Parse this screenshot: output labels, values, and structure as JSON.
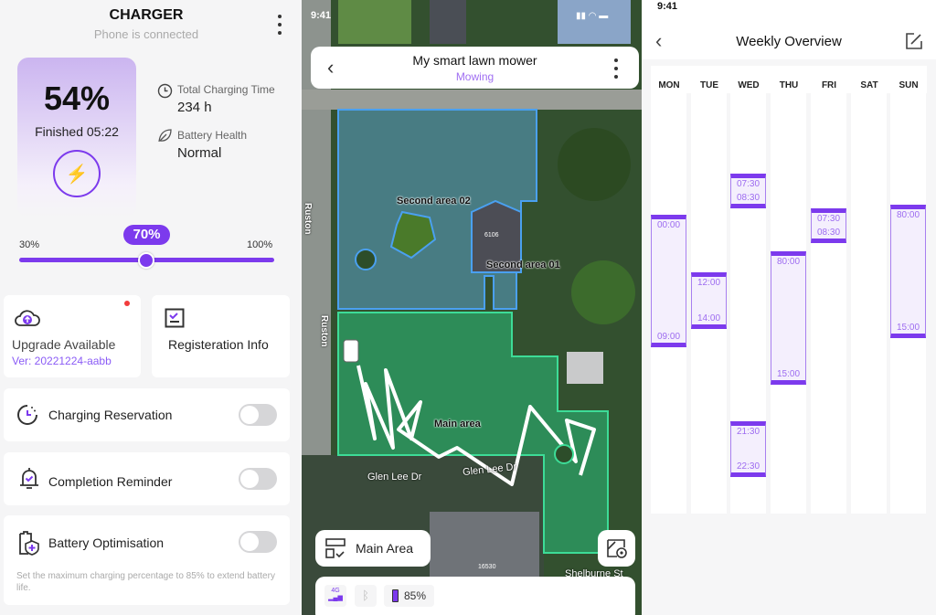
{
  "charger": {
    "title": "CHARGER",
    "subtitle": "Phone is connected",
    "battery_percent": "54%",
    "finished": "Finished 05:22",
    "total_time_label": "Total Charging Time",
    "total_time_value": "234 h",
    "health_label": "Battery Health",
    "health_value": "Normal",
    "slider": {
      "min_label": "30%",
      "max_label": "100%",
      "value_label": "70%",
      "value": 70,
      "min": 30,
      "max": 100
    },
    "upgrade": {
      "label": "Upgrade Available",
      "version": "Ver: 20221224-aabb"
    },
    "registration": {
      "label": "Registeration Info"
    },
    "toggles": [
      {
        "label": "Charging Reservation",
        "on": false
      },
      {
        "label": "Completion Reminder",
        "on": false
      },
      {
        "label": "Battery Optimisation",
        "on": false
      }
    ],
    "optimisation_note": "Set the maximum charging percentage to 85% to extend battery life.",
    "accent": "#7c3aed"
  },
  "mower": {
    "status_time": "9:41",
    "title": "My smart lawn mower",
    "status": "Mowing",
    "map_labels": {
      "area02": "Second area 02",
      "area01": "Second area 01",
      "main": "Main area",
      "street1": "Ruston",
      "street2": "Ruston",
      "street3": "Glen Lee Dr",
      "street4": "Glen Lee Dr",
      "street5": "Shelburne St",
      "house1": "6106",
      "house2": "16530"
    },
    "area_button": "Main Area",
    "battery": "85%",
    "network": "4G"
  },
  "weekly": {
    "status_time": "9:41",
    "title": "Weekly Overview",
    "days": [
      "MON",
      "TUE",
      "WED",
      "THU",
      "FRI",
      "SAT",
      "SUN"
    ],
    "blocks": [
      {
        "day": "MON",
        "start": "00:00",
        "end": "09:00"
      },
      {
        "day": "TUE",
        "start": "12:00",
        "end": "14:00"
      },
      {
        "day": "WED",
        "start": "07:30",
        "end": "08:30"
      },
      {
        "day": "WED",
        "start": "21:30",
        "end": "22:30"
      },
      {
        "day": "THU",
        "start": "80:00",
        "end": "15:00"
      },
      {
        "day": "FRI",
        "start": "07:30",
        "end": "08:30"
      },
      {
        "day": "SUN",
        "start": "80:00",
        "end": "15:00"
      }
    ]
  }
}
